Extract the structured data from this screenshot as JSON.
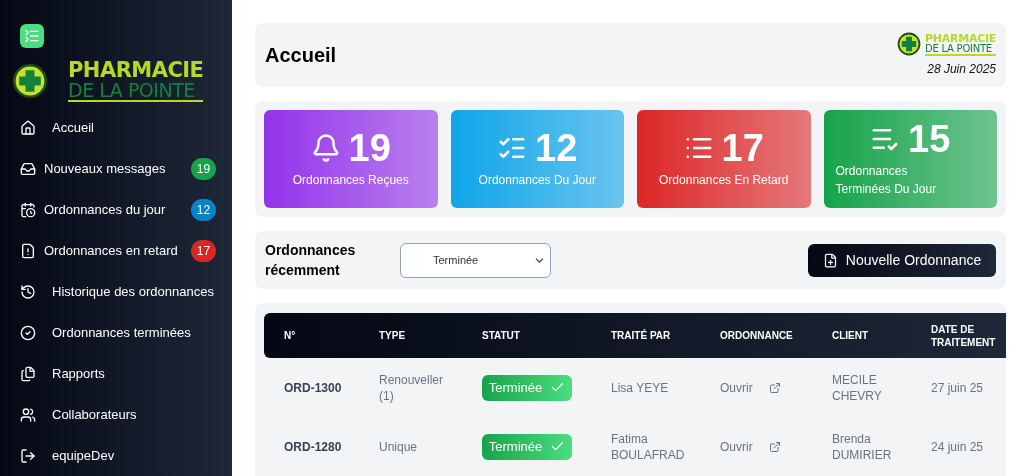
{
  "sidebar": {
    "logo": {
      "line1": "PHARMACIE",
      "line2": "DE LA POINTE"
    },
    "items": [
      {
        "label": "Accueil"
      },
      {
        "label": "Nouveaux messages",
        "badge": "19",
        "color": "#16a34a"
      },
      {
        "label": "Ordonnances du jour",
        "badge": "12",
        "color": "#0284c7"
      },
      {
        "label": "Ordonnances en retard",
        "badge": "17",
        "color": "#dc2626"
      },
      {
        "label": "Historique des ordonnances"
      },
      {
        "label": "Ordonnances terminées"
      },
      {
        "label": "Rapports"
      },
      {
        "label": "Collaborateurs"
      },
      {
        "label": "equipeDev"
      }
    ]
  },
  "header": {
    "title": "Accueil",
    "logo": {
      "line1": "PHARMACIE",
      "line2": "DE LA POINTE"
    },
    "date": "28 Juin 2025"
  },
  "stats": [
    {
      "value": "19",
      "label": "Ordonnances Reçues",
      "color": "#9333ea"
    },
    {
      "value": "12",
      "label": "Ordonnances Du Jour",
      "color": "#0ea5e9"
    },
    {
      "value": "17",
      "label": "Ordonnances En Retard",
      "color": "#dc2626"
    },
    {
      "value": "15",
      "label": "Ordonnances Terminées Du Jour",
      "color": "#16a34a"
    }
  ],
  "filter": {
    "title": "Ordonnances récemment",
    "select_value": "Terminée",
    "button": "Nouvelle Ordonnance"
  },
  "table": {
    "columns": [
      "N°",
      "TYPE",
      "STATUT",
      "TRAITÉ PAR",
      "ORDONNANCE",
      "CLIENT",
      "DATE DE TRAITEMENT"
    ],
    "rows": [
      {
        "number": "ORD-1300",
        "type": "Renouveller (1)",
        "status": "Terminée",
        "handled_by": "Lisa YEYE",
        "link": "Ouvrir",
        "client": "MECILE CHEVRY",
        "date": "27 juin 25"
      },
      {
        "number": "ORD-1280",
        "type": "Unique",
        "status": "Terminée",
        "handled_by": "Fatima BOULAFRAD",
        "link": "Ouvrir",
        "client": "Brenda DUMIRIER",
        "date": "24 juin 25"
      }
    ]
  }
}
